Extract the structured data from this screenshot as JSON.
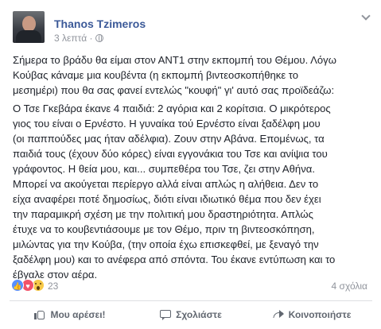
{
  "post": {
    "author": "Thanos Tzimeros",
    "time": "3 λεπτά ·",
    "privacy_icon": "globe-icon",
    "paragraphs": [
      [
        "Σήμερα το βράδυ θα είμαι στον ΑΝΤ1 στην εκπομπή του Θέμου. Λόγω",
        "Κούβας κάναμε μια κουβέντα (η εκπομπή βιντεοσκοπήθηκε το",
        "μεσημέρι) που θα σας φανεί εντελώς \"κουφή\" γι' αυτό σας προϊδεάζω:"
      ],
      [
        "Ο Τσε Γκεβάρα έκανε 4 παιδιά: 2 αγόρια και 2 κορίτσια. Ο μικρότερος",
        "γιος του είναι ο Ερνέστο. Η γυναίκα τού Ερνέστο είναι ξαδέλφη μου",
        "(οι παππούδες μας ήταν αδέλφια). Ζουν στην Αβάνα. Επομένως, τα",
        "παιδιά τους (έχουν δύο κόρες) είναι εγγονάκια του Τσε και ανίψια του",
        "γράφοντος. Η θεία μου, και... συμπεθέρα του Τσε, ζει στην Αθήνα.",
        "Μπορεί να ακούγεται περίεργο αλλά είναι απλώς η αλήθεια. Δεν το",
        "είχα αναφέρει ποτέ δημοσίως, διότι είναι ιδιωτικό θέμα που δεν έχει",
        "την παραμικρή σχέση με την πολιτική μου δραστηριότητα. Απλώς",
        "έτυχε να το κουβεντιάσουμε με τον Θέμο, πριν τη βιντεοσκόπηση,",
        "μιλώντας για την Κούβα, (την οποία έχω επισκεφθεί, με ξεναγό την",
        "ξαδέλφη μου) και το ανέφερα από σπόντα. Του έκανε εντύπωση και το",
        "έβγαλε στον αέρα."
      ]
    ]
  },
  "reactions": {
    "icons": [
      "like-icon",
      "love-icon",
      "wow-icon"
    ],
    "count": "23",
    "comments": "4 σχόλια"
  },
  "actions": {
    "like": "Μου αρέσει!",
    "comment": "Σχολιάστε",
    "share": "Κοινοποιήστε"
  }
}
